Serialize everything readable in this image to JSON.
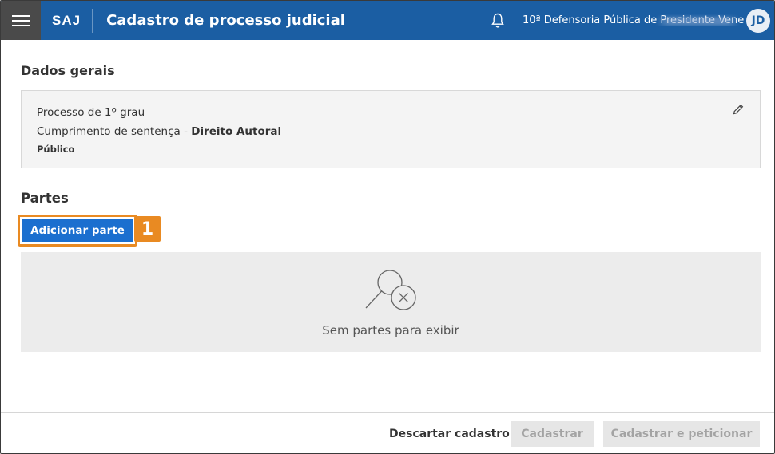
{
  "header": {
    "brand": "SAJ",
    "title": "Cadastro de processo judicial",
    "organization": "10ª Defensoria Pública de Presidente Vene",
    "avatar_initials": "JD"
  },
  "dados_gerais": {
    "title": "Dados gerais",
    "grau": "Processo de 1º grau",
    "classe": "Cumprimento de sentença",
    "separator": " - ",
    "assunto": "Direito Autoral",
    "visibilidade": "Público"
  },
  "partes": {
    "title": "Partes",
    "add_label": "Adicionar parte",
    "step_number": "1",
    "empty_text": "Sem partes para exibir"
  },
  "footer": {
    "discard_label": "Descartar cadastro",
    "save_label": "Cadastrar",
    "save_petition_label": "Cadastrar e peticionar"
  },
  "colors": {
    "header_bg": "#1b5ea3",
    "primary": "#1b6fcf",
    "highlight": "#e98a22"
  }
}
